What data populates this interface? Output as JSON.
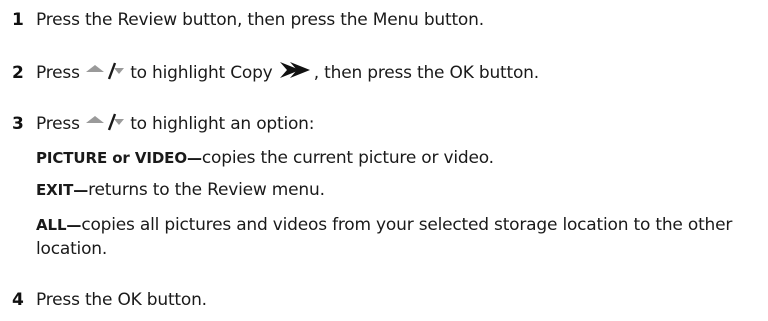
{
  "steps": [
    {
      "number": "1",
      "text": "Press the Review button, then press the Menu button."
    },
    {
      "number": "2",
      "before_icon": "Press",
      "icon": "up-down-arrow-icon",
      "middle": "to highlight Copy",
      "copy_icon": "fast-forward-icon",
      "after": ", then press the OK button."
    },
    {
      "number": "3",
      "before_icon": "Press",
      "icon": "up-down-arrow-icon",
      "after": "to highlight an option:",
      "options": [
        {
          "label": "PICTURE or VIDEO—",
          "desc": "copies the current picture or video."
        },
        {
          "label": "EXIT—",
          "desc": "returns to the Review menu."
        },
        {
          "label": "ALL—",
          "desc": "copies all pictures and videos from your selected storage location to the other location."
        }
      ]
    },
    {
      "number": "4",
      "text": "Press the OK button."
    }
  ],
  "colors": {
    "text": "#1a1a1a",
    "arrow_icon": "#9a9a9a",
    "copy_icon": "#111111"
  }
}
